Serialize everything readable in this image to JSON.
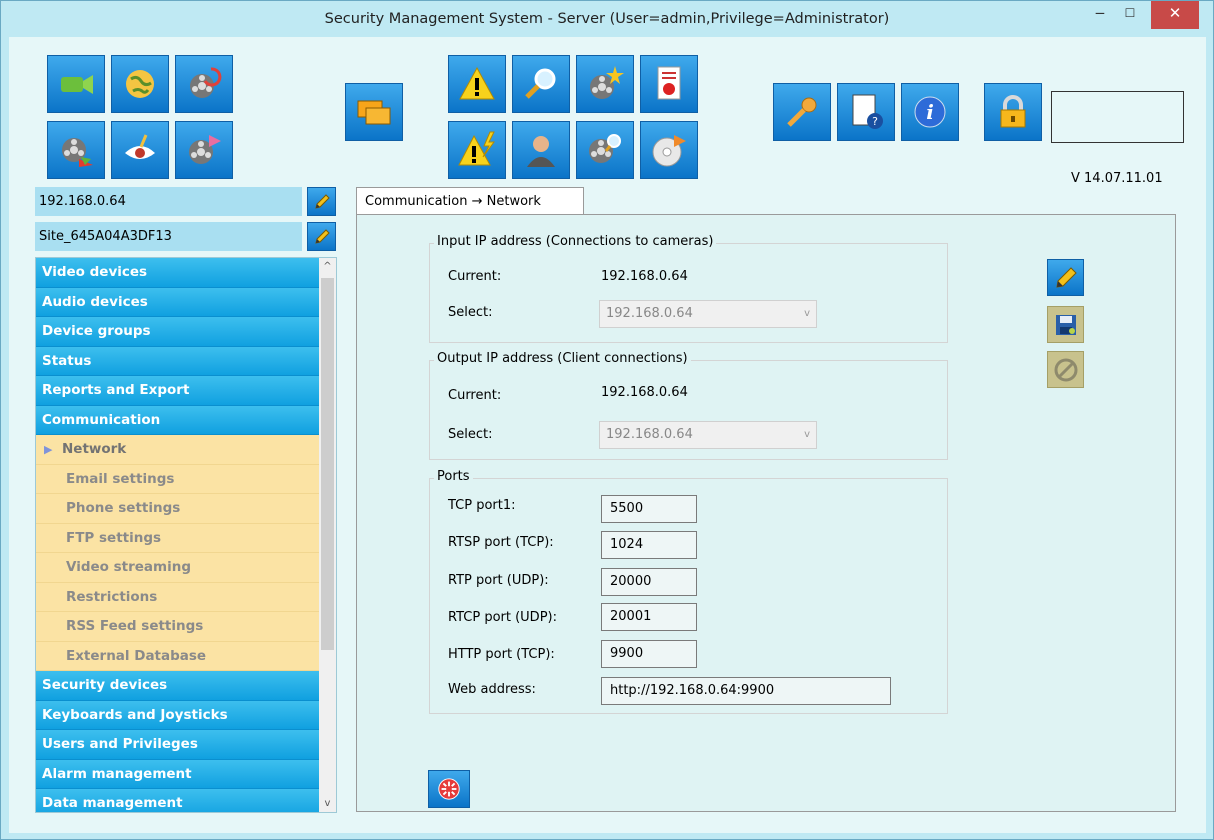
{
  "window": {
    "title": "Security Management System - Server (User=admin,Privilege=Administrator)",
    "minimize": "‒",
    "maximize": "☐",
    "close": "✕"
  },
  "toolbar": {
    "icons": [
      "camera-icon",
      "globe-icon",
      "film-refresh-icon",
      "film-icon",
      "eye-icon",
      "film-export-icon",
      "windows-icon",
      "warning-icon",
      "search-icon",
      "film-star-icon",
      "report-icon",
      "warning-lightning-icon",
      "user-icon",
      "film-search-icon",
      "disc-export-icon",
      "key-icon",
      "help-document-icon",
      "info-icon",
      "lock-icon"
    ],
    "version": "V 14.07.11.01"
  },
  "left": {
    "server_ip": "192.168.0.64",
    "site_name": "Site_645A04A3DF13"
  },
  "nav": {
    "items": [
      {
        "label": "Video devices"
      },
      {
        "label": "Audio devices"
      },
      {
        "label": "Device groups"
      },
      {
        "label": "Status"
      },
      {
        "label": "Reports and Export"
      },
      {
        "label": "Communication"
      },
      {
        "label": "Network",
        "arrow": "▶"
      },
      {
        "label": "Email settings"
      },
      {
        "label": "Phone settings"
      },
      {
        "label": "FTP settings"
      },
      {
        "label": "Video streaming"
      },
      {
        "label": "Restrictions"
      },
      {
        "label": "RSS Feed settings"
      },
      {
        "label": "External Database"
      },
      {
        "label": "Security devices"
      },
      {
        "label": "Keyboards and Joysticks"
      },
      {
        "label": "Users and Privileges"
      },
      {
        "label": "Alarm management"
      },
      {
        "label": "Data management"
      }
    ],
    "scroll_up": "^",
    "scroll_down": "v"
  },
  "tab": {
    "label": "Communication → Network"
  },
  "input_ip": {
    "title": "Input IP address (Connections to cameras)",
    "current_label": "Current:",
    "current_value": "192.168.0.64",
    "select_label": "Select:",
    "select_value": "192.168.0.64"
  },
  "output_ip": {
    "title": "Output IP address (Client connections)",
    "current_label": "Current:",
    "current_value": "192.168.0.64",
    "select_label": "Select:",
    "select_value": "192.168.0.64"
  },
  "ports": {
    "title": "Ports",
    "tcp_port1_label": "TCP port1:",
    "tcp_port1": "5500",
    "rtsp_label": "RTSP port (TCP):",
    "rtsp": "1024",
    "rtp_label": "RTP port (UDP):",
    "rtp": "20000",
    "rtcp_label": "RTCP port (UDP):",
    "rtcp": "20001",
    "http_label": "HTTP port (TCP):",
    "http": "9900",
    "web_label": "Web address:",
    "web": "http://192.168.0.64:9900"
  },
  "chevron": "v",
  "colors": {
    "nav_main": "#22b0ea",
    "nav_sub": "#fbe3a4",
    "client_bg": "#e6f7f8",
    "button_blue": "#1a84d4"
  }
}
